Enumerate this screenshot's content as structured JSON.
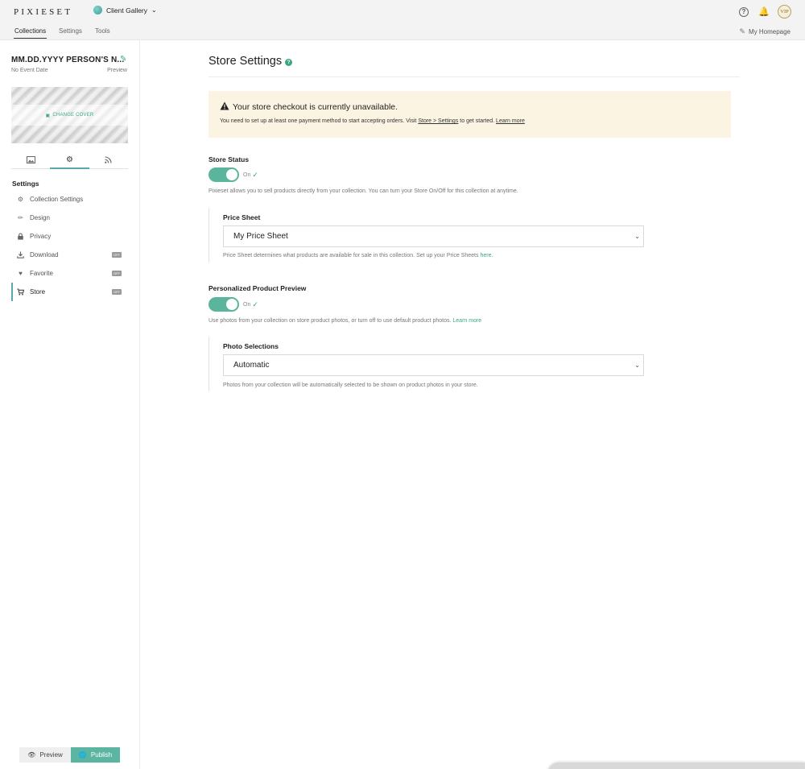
{
  "topbar": {
    "brand": "PIXIESET",
    "gallery_switch": "Client Gallery",
    "vip": "VIP"
  },
  "subnav": {
    "tabs": [
      {
        "label": "Collections",
        "active": true
      },
      {
        "label": "Settings",
        "active": false
      },
      {
        "label": "Tools",
        "active": false
      }
    ],
    "homepage": "My Homepage"
  },
  "sidebar": {
    "collection_title": "MM.DD.YYYY PERSON'S N...",
    "event_date": "No Event Date",
    "preview": "Preview",
    "change_cover": "CHANGE COVER",
    "tabs": [
      "photos-icon",
      "gear-icon",
      "rss-icon"
    ],
    "settings_heading": "Settings",
    "menu": [
      {
        "label": "Collection Settings",
        "icon": "gear-icon"
      },
      {
        "label": "Design",
        "icon": "brush-icon"
      },
      {
        "label": "Privacy",
        "icon": "lock-icon"
      },
      {
        "label": "Download",
        "icon": "download-icon",
        "badge": "OFF"
      },
      {
        "label": "Favorite",
        "icon": "heart-icon",
        "badge": "OFF"
      },
      {
        "label": "Store",
        "icon": "cart-icon",
        "badge": "OFF",
        "active": true
      }
    ],
    "preview_button": "Preview",
    "publish_button": "Publish"
  },
  "main": {
    "title": "Store Settings",
    "alert": {
      "title": "Your store checkout is currently unavailable.",
      "body_prefix": "You need to set up at least one payment method to start accepting orders. Visit ",
      "body_link": "Store > Settings",
      "body_middle": " to get started. ",
      "learn_more": "Learn more"
    },
    "store_status": {
      "label": "Store Status",
      "state": "On",
      "helper": "Pixieset allows you to sell products directly from your collection. You can turn your Store On/Off for this collection at anytime."
    },
    "price_sheet": {
      "label": "Price Sheet",
      "value": "My Price Sheet",
      "helper_prefix": "Price Sheet determines what products are available for sale in this collection. Set up your Price Sheets ",
      "helper_link": "here",
      "helper_suffix": "."
    },
    "product_preview": {
      "label": "Personalized Product Preview",
      "state": "On",
      "helper_prefix": "Use photos from your collection on store product photos, or turn off to use default product photos. ",
      "helper_link": "Learn more"
    },
    "photo_selections": {
      "label": "Photo Selections",
      "value": "Automatic",
      "helper": "Photos from your collection will be automatically selected to be shown on product photos in your store."
    }
  },
  "colors": {
    "accent": "#3aa685",
    "toggle_on": "#5bb59c",
    "alert_bg": "#fcf4e3",
    "publish_bg": "#5bb5a0"
  }
}
